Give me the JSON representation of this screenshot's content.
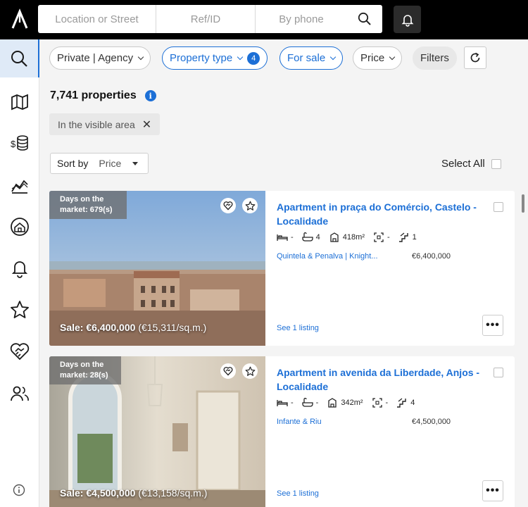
{
  "search": {
    "location_placeholder": "Location or Street",
    "ref_placeholder": "Ref/ID",
    "phone_placeholder": "By phone"
  },
  "sidebar": {
    "items": [
      {
        "icon": "search-icon",
        "active": true
      },
      {
        "icon": "map-icon"
      },
      {
        "icon": "coins-icon"
      },
      {
        "icon": "chart-area-icon"
      },
      {
        "icon": "home-search-icon"
      },
      {
        "icon": "bell-icon"
      },
      {
        "icon": "star-icon"
      },
      {
        "icon": "handshake-icon"
      },
      {
        "icon": "users-icon"
      }
    ]
  },
  "filters": {
    "agency_label": "Private | Agency",
    "property_type_label": "Property type",
    "property_type_count": "4",
    "for_sale_label": "For sale",
    "price_label": "Price",
    "filters_label": "Filters"
  },
  "results": {
    "count": "7,741 properties",
    "info_glyph": "i",
    "area_chip": "In the visible area",
    "sort_label": "Sort by",
    "sort_value": "Price",
    "select_all": "Select All"
  },
  "listings": [
    {
      "days": "Days on the market: 679(s)",
      "price_overlay_bold": "Sale: €6,400,000",
      "price_overlay_sqm": "(€15,311/sq.m.)",
      "title": "Apartment in praça do Comércio, Castelo - Localidade",
      "beds": "-",
      "baths": "4",
      "area": "418m²",
      "rooms": "-",
      "floor": "1",
      "agency": "Quintela & Penalva | Knight...",
      "price": "€6,400,000",
      "see_listing": "See 1 listing"
    },
    {
      "days": "Days on the market: 28(s)",
      "price_overlay_bold": "Sale: €4,500,000",
      "price_overlay_sqm": "(€13,158/sq.m.)",
      "title": "Apartment in avenida da Liberdade, Anjos - Localidade",
      "beds": "-",
      "baths": "-",
      "area": "342m²",
      "rooms": "-",
      "floor": "4",
      "agency": "Infante & Riu",
      "price": "€4,500,000",
      "see_listing": "See 1 listing"
    }
  ],
  "colors": {
    "accent": "#1c6fd6",
    "topbar": "#000000",
    "active_sidebar": "#dfeaf7"
  }
}
